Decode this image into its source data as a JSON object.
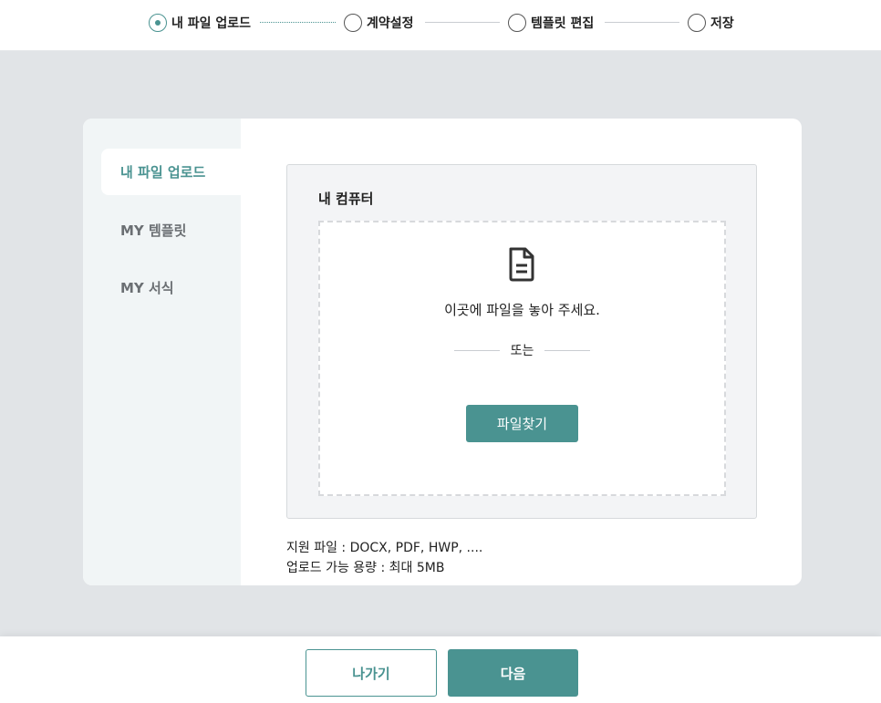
{
  "stepper": {
    "steps": [
      {
        "label": "내 파일 업로드",
        "active": true
      },
      {
        "label": "계약설정",
        "active": false
      },
      {
        "label": "템플릿 편집",
        "active": false
      },
      {
        "label": "저장",
        "active": false
      }
    ]
  },
  "sidebar": {
    "items": [
      {
        "label": "내 파일 업로드",
        "active": true
      },
      {
        "label": "MY 템플릿",
        "active": false
      },
      {
        "label": "MY 서식",
        "active": false
      }
    ]
  },
  "upload": {
    "panel_title": "내 컴퓨터",
    "drop_icon": "document-icon",
    "drop_text": "이곳에 파일을 놓아 주세요.",
    "or_text": "또는",
    "find_button": "파일찾기",
    "supported_files": "지원 파일 : DOCX, PDF, HWP, ....",
    "max_size": "업로드 가능 용량 : 최대 5MB"
  },
  "footer": {
    "exit_label": "나가기",
    "next_label": "다음"
  },
  "colors": {
    "accent": "#4a9391",
    "background": "#e1e4e7",
    "sidebar_bg": "#f1f5f6"
  }
}
